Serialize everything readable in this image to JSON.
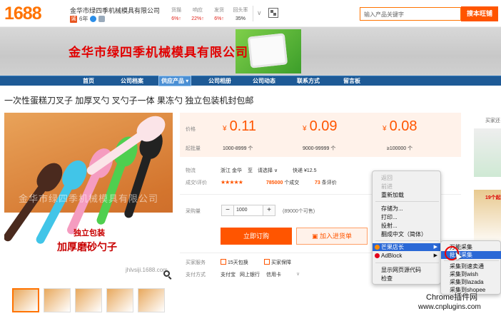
{
  "header": {
    "logo": "1688",
    "shop_name": "金华市绿四季机械模具有限公司",
    "years": "6年",
    "stats": [
      {
        "label": "货描",
        "value": "6%↑"
      },
      {
        "label": "响应",
        "value": "22%↑"
      },
      {
        "label": "发货",
        "value": "6%↑"
      },
      {
        "label": "回头率",
        "value": "35%"
      }
    ],
    "search_placeholder": "输入产品关键字",
    "search_button": "搜本旺铺"
  },
  "banner": {
    "company": "金华市绿四季机械模具有限公司"
  },
  "nav": {
    "items": [
      "首页",
      "公司档案",
      "供应产品",
      "公司相册",
      "公司动态",
      "联系方式",
      "留言板"
    ]
  },
  "product": {
    "title": "一次性蛋糕刀叉子 加厚叉勺 叉勺子一体 果冻勺 独立包装机封包邮",
    "image_watermark": "金华市绿四季机械模具有限公司",
    "image_label1": "独立包装",
    "image_label2": "加厚磨砂勺子",
    "image_site": "jhlvsiji.1688.com"
  },
  "pricing": {
    "price_label": "价格",
    "moq_label": "起批量",
    "currency": "¥",
    "tiers": [
      {
        "price": "0.11",
        "range": "1000-8999 个"
      },
      {
        "price": "0.09",
        "range": "9000-99999 个"
      },
      {
        "price": "0.08",
        "range": "≥100000 个"
      }
    ]
  },
  "logistics": {
    "label": "物流",
    "origin": "浙江 金华",
    "to": "至",
    "select": "请选择 ∨",
    "express": "快递 ¥12.5"
  },
  "rating": {
    "label": "成交\\评价",
    "stars": "★★★★★",
    "deals": "785000",
    "deals_suffix": "个成交",
    "reviews": "73",
    "reviews_suffix": "条评价"
  },
  "purchase": {
    "label": "采购量",
    "minus": "−",
    "quantity": "1000",
    "plus": "+",
    "available": "(89000个可售)",
    "buy_button": "立即订购",
    "cart_button": "加入进货单"
  },
  "service": {
    "label": "买家服务",
    "items": [
      "15天包换",
      "买家保障"
    ]
  },
  "payment": {
    "label": "支付方式",
    "items": [
      "支付宝",
      "网上银行",
      "信用卡"
    ]
  },
  "right_panel": {
    "title": "买家还",
    "tag": "19个起"
  },
  "context_menu": {
    "items": [
      "返回",
      "前进",
      "重新加载",
      "存储为...",
      "打印...",
      "投射...",
      "翻成中文（简体）",
      "芒果店长",
      "AdBlock",
      "显示网页源代码",
      "检查"
    ]
  },
  "submenu": {
    "items": [
      "万能采集",
      "批量采集",
      "采集到速卖通",
      "采集到wish",
      "采集到lazada",
      "采集到shopee"
    ]
  },
  "watermark": {
    "line1": "Chrome插件网",
    "line2": "www.cnplugins.com"
  }
}
